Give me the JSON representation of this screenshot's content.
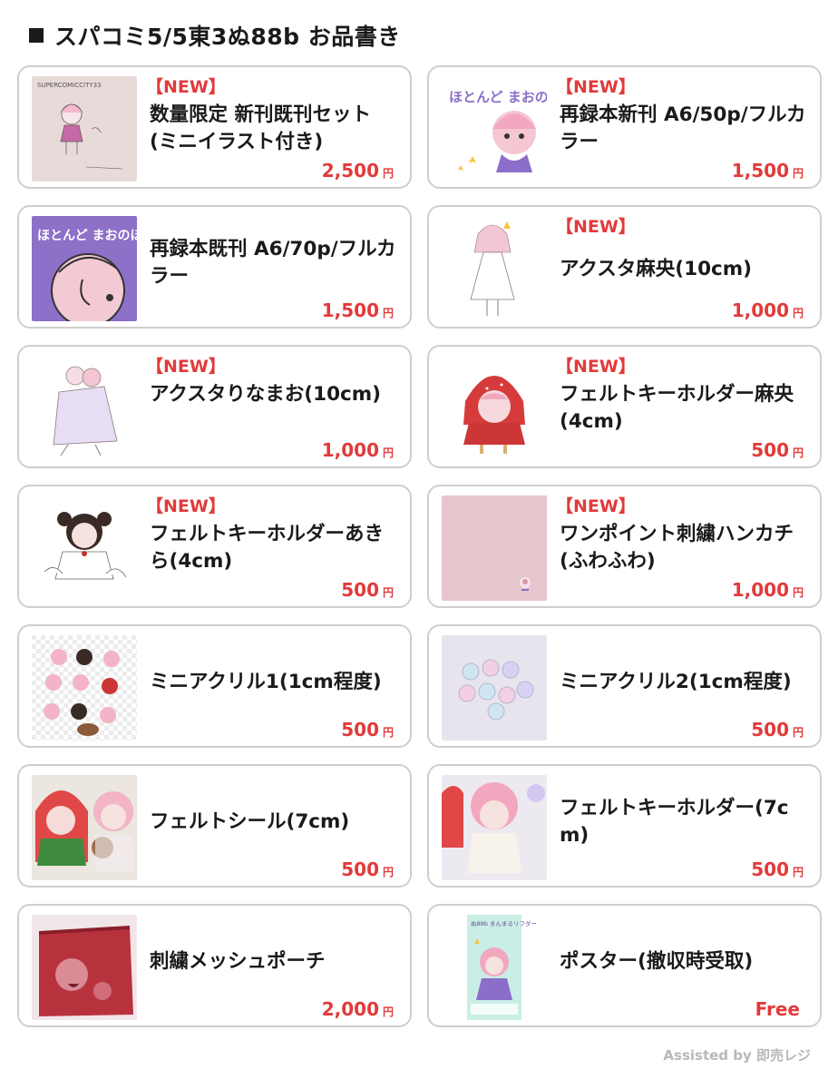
{
  "header": {
    "title": "スパコミ5/5東3ぬ88b お品書き"
  },
  "items": [
    {
      "badge": "【NEW】",
      "name": "数量限定 新刊既刊セット(ミニイラスト付き)",
      "price": "2,500",
      "yen": "円",
      "thumb": "sketch-set-image",
      "thumb_text": "SUPERCOMICCITY33"
    },
    {
      "badge": "【NEW】",
      "name": "再録本新刊 A6/50p/フルカラー",
      "price": "1,500",
      "yen": "円",
      "thumb": "book-cover-new-image",
      "thumb_text": "ほとんど まおのほん"
    },
    {
      "badge": "",
      "name": "再録本既刊 A6/70p/フルカラー",
      "price": "1,500",
      "yen": "円",
      "thumb": "book-cover-old-image",
      "thumb_text": "ほとんど まおのほん"
    },
    {
      "badge": "【NEW】",
      "name": "アクスタ麻央(10cm)",
      "price": "1,000",
      "yen": "円",
      "thumb": "acrylic-stand-mao-image"
    },
    {
      "badge": "【NEW】",
      "name": "アクスタりなまお(10cm)",
      "price": "1,000",
      "yen": "円",
      "thumb": "acrylic-stand-rinamao-image"
    },
    {
      "badge": "【NEW】",
      "name": "フェルトキーホルダー麻央(4cm)",
      "price": "500",
      "yen": "円",
      "thumb": "felt-keyholder-mao-image"
    },
    {
      "badge": "【NEW】",
      "name": "フェルトキーホルダーあきら(4cm)",
      "price": "500",
      "yen": "円",
      "thumb": "felt-keyholder-akira-image"
    },
    {
      "badge": "【NEW】",
      "name": "ワンポイント刺繍ハンカチ(ふわふわ)",
      "price": "1,000",
      "yen": "円",
      "thumb": "handkerchief-image"
    },
    {
      "badge": "",
      "name": "ミニアクリル1(1cm程度)",
      "price": "500",
      "yen": "円",
      "thumb": "mini-acrylic-1-image"
    },
    {
      "badge": "",
      "name": "ミニアクリル2(1cm程度)",
      "price": "500",
      "yen": "円",
      "thumb": "mini-acrylic-2-image"
    },
    {
      "badge": "",
      "name": "フェルトシール(7cm)",
      "price": "500",
      "yen": "円",
      "thumb": "felt-sticker-image"
    },
    {
      "badge": "",
      "name": "フェルトキーホルダー(7cm)",
      "price": "500",
      "yen": "円",
      "thumb": "felt-keyholder-7cm-image"
    },
    {
      "badge": "",
      "name": "刺繍メッシュポーチ",
      "price": "2,000",
      "yen": "円",
      "thumb": "mesh-pouch-image"
    },
    {
      "badge": "",
      "name": "ポスター(撤収時受取)",
      "price": "Free",
      "yen": "",
      "thumb": "poster-image",
      "thumb_text": "ぬ88b まんまるリフダー"
    }
  ],
  "footer": {
    "text": "Assisted by 即売レジ"
  },
  "colors": {
    "accent": "#e13a3a",
    "border": "#cfcfcf",
    "footer": "#b8b8b8"
  }
}
